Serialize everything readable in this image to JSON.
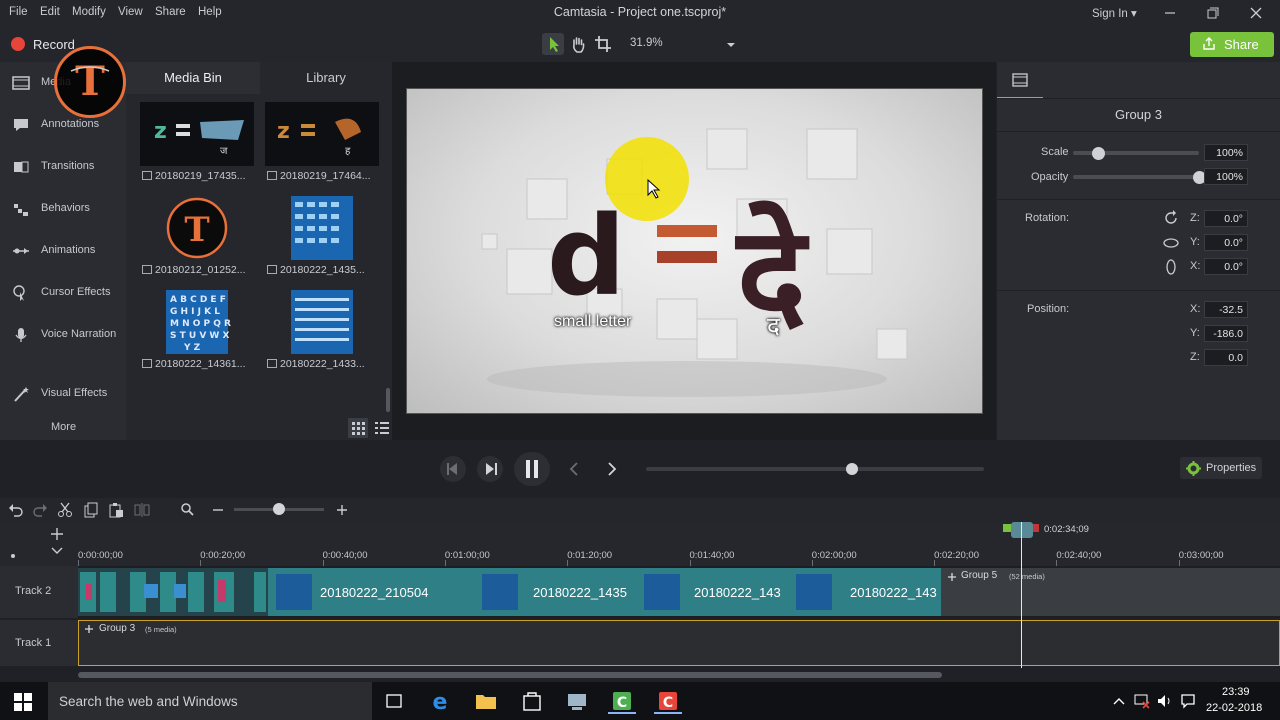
{
  "menu": [
    "File",
    "Edit",
    "Modify",
    "View",
    "Share",
    "Help"
  ],
  "window_title": "Camtasia - Project one.tscproj*",
  "sign_in": "Sign In",
  "toolbar": {
    "record_label": "Record",
    "zoom": "31.9%",
    "share_label": "Share"
  },
  "tools": [
    {
      "label": "Media",
      "icon": "film-icon"
    },
    {
      "label": "Annotations",
      "icon": "annotations-icon"
    },
    {
      "label": "Transitions",
      "icon": "transitions-icon"
    },
    {
      "label": "Behaviors",
      "icon": "behaviors-icon"
    },
    {
      "label": "Animations",
      "icon": "animations-icon"
    },
    {
      "label": "Cursor Effects",
      "icon": "cursor-icon"
    },
    {
      "label": "Voice Narration",
      "icon": "microphone-icon"
    },
    {
      "label": "Visual Effects",
      "icon": "wand-icon"
    }
  ],
  "more_label": "More",
  "media_bin": {
    "tabs": [
      "Media Bin",
      "Library"
    ],
    "items": [
      "20180219_17435...",
      "20180219_17464...",
      "20180212_01252...",
      "20180222_1435...",
      "20180222_14361...",
      "20180222_1433..."
    ],
    "thumb_text": {
      "t1": "ज",
      "t2": "ह"
    }
  },
  "canvas": {
    "caption_left": "small letter",
    "caption_right": "द",
    "glyph_left": "d",
    "glyph_right": "दे"
  },
  "properties": {
    "title": "Group 3",
    "scale_label": "Scale",
    "scale": "100%",
    "scale_fraction": 0.2,
    "opacity_label": "Opacity",
    "opacity": "100%",
    "opacity_fraction": 1.0,
    "rotation_label": "Rotation:",
    "rotation": [
      {
        "axis": "Z:",
        "value": "0.0°"
      },
      {
        "axis": "Y:",
        "value": "0.0°"
      },
      {
        "axis": "X:",
        "value": "0.0°"
      }
    ],
    "position_label": "Position:",
    "position": [
      {
        "axis": "X:",
        "value": "-32.5"
      },
      {
        "axis": "Y:",
        "value": "-186.0"
      },
      {
        "axis": "Z:",
        "value": "0.0"
      }
    ],
    "properties_button": "Properties"
  },
  "player": {
    "progress": 0.61
  },
  "timeline": {
    "playhead_time": "0:02:34;09",
    "ticks": [
      "0:00:00;00",
      "0:00:20;00",
      "0:00:40;00",
      "0:01:00;00",
      "0:01:20;00",
      "0:01:40;00",
      "0:02:00;00",
      "0:02:20;00",
      "0:02:40;00",
      "0:03:00;00"
    ],
    "zoom_fraction": 0.5,
    "tracks": [
      "Track 2",
      "Track 1"
    ],
    "clips": [
      "20180222_210504",
      "20180222_1435",
      "20180222_143",
      "20180222_143"
    ],
    "group5": {
      "label": "Group 5",
      "sub": "(52 media)"
    },
    "group3": {
      "label": "Group 3",
      "sub": "(5 media)"
    }
  },
  "taskbar": {
    "search_placeholder": "Search the web and Windows",
    "time": "23:39",
    "date": "22-02-2018"
  },
  "colors": {
    "accent_green": "#78c23c",
    "record_red": "#e8443a",
    "ring_orange": "#e8703a"
  }
}
